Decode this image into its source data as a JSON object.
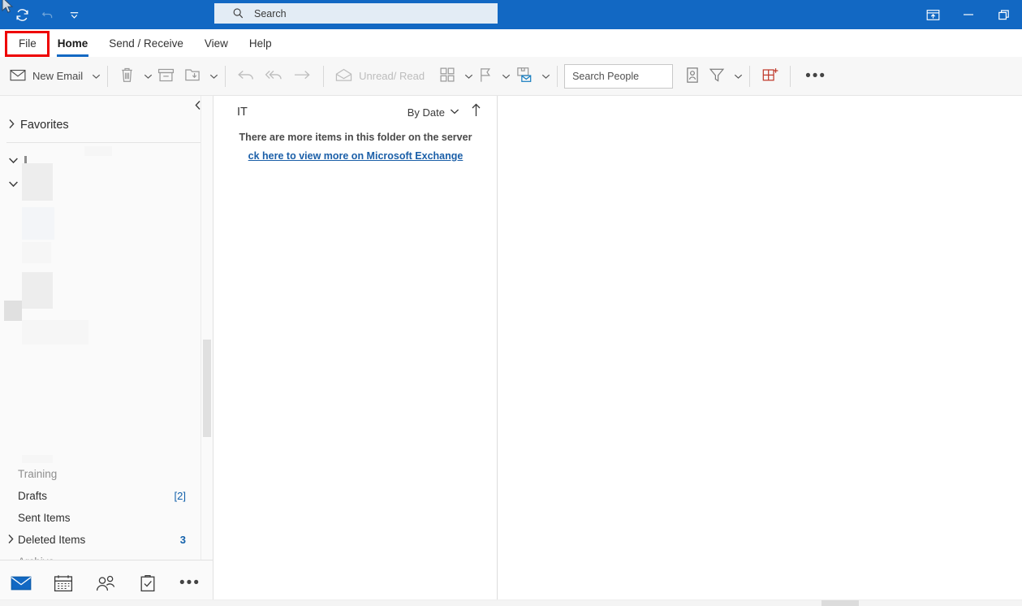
{
  "titlebar": {
    "quick_access": [
      {
        "name": "send-receive-all",
        "label": "Send/Receive All Folders",
        "enabled": true
      },
      {
        "name": "undo",
        "label": "Undo",
        "enabled": false
      },
      {
        "name": "customize-quick-access-toolbar",
        "label": "Customize Quick Access Toolbar",
        "enabled": true
      }
    ],
    "search": {
      "placeholder": "Search",
      "value": "Search"
    },
    "window_controls": [
      {
        "name": "ribbon-display-options",
        "label": "Ribbon Display Options"
      },
      {
        "name": "minimize",
        "label": "Minimize"
      },
      {
        "name": "restore",
        "label": "Restore Down"
      }
    ],
    "background_color": "#1268c3"
  },
  "ribbon_tabs": {
    "items": [
      {
        "label": "File",
        "active": false,
        "highlighted": true
      },
      {
        "label": "Home",
        "active": true,
        "highlighted": false
      },
      {
        "label": "Send / Receive",
        "active": false,
        "highlighted": false
      },
      {
        "label": "View",
        "active": false,
        "highlighted": false
      },
      {
        "label": "Help",
        "active": false,
        "highlighted": false
      }
    ],
    "active_underline_color": "#1268c3",
    "highlight_color": "#ee0000"
  },
  "toolbar": {
    "new_email_label": "New Email",
    "delete_label": "Delete",
    "archive_label": "Archive",
    "move_label": "Move",
    "reply_label": "Reply",
    "reply_all_label": "Reply All",
    "forward_label": "Forward",
    "unread_read_label": "Unread/ Read",
    "categorize_label": "Categorize",
    "flag_label": "Follow Up",
    "rules_label": "Rules",
    "search_people_placeholder": "Search People",
    "address_book_label": "Address Book",
    "filter_email_label": "Filter Email",
    "get_addins_label": "Get Add-ins",
    "more_label": "More commands"
  },
  "navigation_pane": {
    "collapse_label": "Collapse the Folder Pane",
    "favorites_label": "Favorites",
    "accounts": [
      {
        "label": "",
        "expanded": true
      },
      {
        "label": "",
        "expanded": true
      }
    ],
    "folders": [
      {
        "label": "Training",
        "count": "",
        "expandable": false,
        "clipped": true
      },
      {
        "label": "Drafts",
        "count": "[2]",
        "expandable": false,
        "clipped": false
      },
      {
        "label": "Sent Items",
        "count": "",
        "expandable": false,
        "clipped": false
      },
      {
        "label": "Deleted Items",
        "count": "3",
        "expandable": true,
        "clipped": false
      },
      {
        "label": "Archive",
        "count": "",
        "expandable": false,
        "clipped": true
      }
    ]
  },
  "module_bar": {
    "items": [
      {
        "name": "mail",
        "label": "Mail",
        "active": true
      },
      {
        "name": "calendar",
        "label": "Calendar",
        "active": false
      },
      {
        "name": "people",
        "label": "People",
        "active": false
      },
      {
        "name": "tasks",
        "label": "Tasks",
        "active": false
      },
      {
        "name": "more-apps",
        "label": "More",
        "active": false
      }
    ],
    "active_color": "#1268c3"
  },
  "message_list": {
    "folder_name": "IT",
    "sort_label": "By Date",
    "sort_direction_label": "Ascending",
    "empty_note": "There are more items in this folder on the server",
    "server_link": "ck here to view more on Microsoft Exchange",
    "link_color": "#1b5fa8"
  },
  "reading_pane": {
    "content": ""
  }
}
